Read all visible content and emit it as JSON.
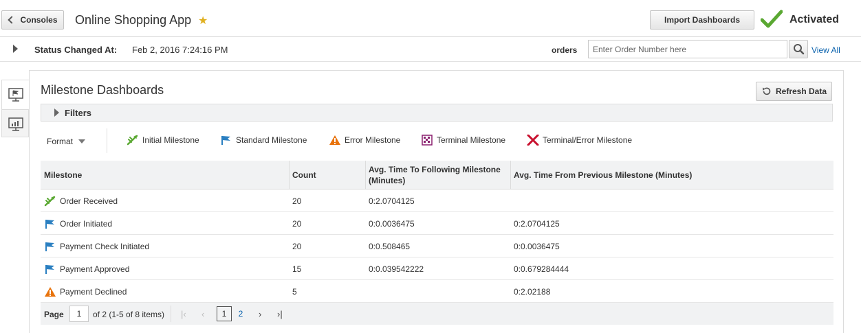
{
  "header": {
    "back_label": "Consoles",
    "app_title": "Online Shopping App",
    "import_label": "Import Dashboards",
    "activated_label": "Activated"
  },
  "status": {
    "label": "Status Changed At:",
    "value": "Feb 2, 2016 7:24:16 PM",
    "orders_label": "orders",
    "order_placeholder": "Enter Order Number here",
    "view_all": "View All"
  },
  "panel": {
    "title": "Milestone Dashboards",
    "refresh_label": "Refresh Data",
    "filters_label": "Filters",
    "format_label": "Format"
  },
  "legend": [
    {
      "label": "Initial Milestone",
      "icon": "initial-milestone-icon"
    },
    {
      "label": "Standard Milestone",
      "icon": "standard-milestone-icon"
    },
    {
      "label": "Error Milestone",
      "icon": "error-milestone-icon"
    },
    {
      "label": "Terminal Milestone",
      "icon": "terminal-milestone-icon"
    },
    {
      "label": "Terminal/Error Milestone",
      "icon": "terminal-error-milestone-icon"
    }
  ],
  "table": {
    "columns": [
      "Milestone",
      "Count",
      "Avg. Time To Following Milestone (Minutes)",
      "Avg. Time From Previous Milestone (Minutes)"
    ],
    "rows": [
      {
        "milestone": "Order Received",
        "type": "initial",
        "count": "20",
        "to_next": "0:2.0704125",
        "from_prev": ""
      },
      {
        "milestone": "Order Initiated",
        "type": "standard",
        "count": "20",
        "to_next": "0:0.0036475",
        "from_prev": "0:2.0704125"
      },
      {
        "milestone": "Payment Check Initiated",
        "type": "standard",
        "count": "20",
        "to_next": "0:0.508465",
        "from_prev": "0:0.0036475"
      },
      {
        "milestone": "Payment Approved",
        "type": "standard",
        "count": "15",
        "to_next": "0:0.039542222",
        "from_prev": "0:0.679284444"
      },
      {
        "milestone": "Payment Declined",
        "type": "error",
        "count": "5",
        "to_next": "",
        "from_prev": "0:2.02188"
      }
    ]
  },
  "pager": {
    "page_label": "Page",
    "current_page": "1",
    "of_text": "of 2 (1-5 of 8 items)",
    "pages": [
      "1",
      "2"
    ]
  },
  "colors": {
    "accent_green": "#5aa832",
    "flag_blue": "#2a7fc1",
    "error_orange": "#e8730c",
    "terminal_purple": "#8a1f6e",
    "terminal_error_red": "#c8102e",
    "link_blue": "#0a62ad"
  }
}
